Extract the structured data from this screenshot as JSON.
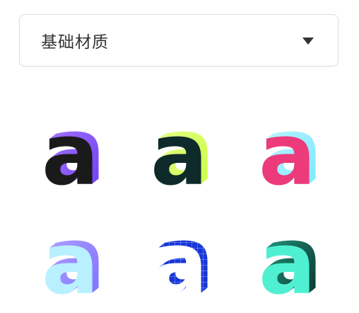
{
  "dropdown": {
    "selected": "基础材质"
  },
  "materials": [
    {
      "id": "purple-chrome",
      "icon": "letter-a-purple-chrome-icon",
      "letter": "a",
      "face": "#1a1a1a",
      "side": "#6a3cf5",
      "side_light": "#b07cff"
    },
    {
      "id": "lime-dark",
      "icon": "letter-a-lime-icon",
      "letter": "a",
      "face": "#0f2a2a",
      "side": "#c9ff3a",
      "side_light": "#eaff9a"
    },
    {
      "id": "pink-cyan",
      "icon": "letter-a-pink-cyan-icon",
      "letter": "a",
      "face": "#ec3a7a",
      "side": "#74e6ff",
      "side_light": "#c9f6ff"
    },
    {
      "id": "lavender-blue",
      "icon": "letter-a-lavender-icon",
      "letter": "a",
      "face": "#b9f0ff",
      "side": "#7a6cff",
      "side_light": "#b7a9ff"
    },
    {
      "id": "blue-grid",
      "icon": "letter-a-blue-grid-icon",
      "letter": "a",
      "face": "#ffffff",
      "side": "#1636d6",
      "side_light": "#4a66ff"
    },
    {
      "id": "mint-dark",
      "icon": "letter-a-mint-icon",
      "letter": "a",
      "face": "#4ff0d1",
      "side": "#0a2a24",
      "side_light": "#24a88d"
    }
  ]
}
